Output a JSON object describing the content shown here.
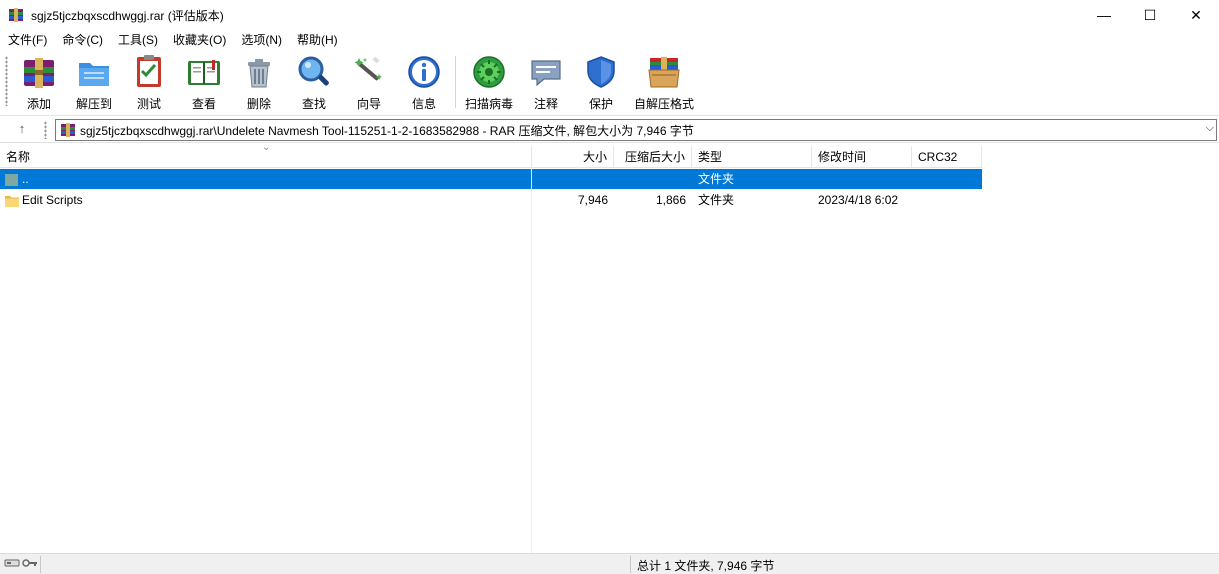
{
  "window": {
    "title": "sgjz5tjczbqxscdhwggj.rar (评估版本)",
    "minimize": "—",
    "maximize": "☐",
    "close": "✕"
  },
  "menu": [
    {
      "label": "文件(F)"
    },
    {
      "label": "命令(C)"
    },
    {
      "label": "工具(S)"
    },
    {
      "label": "收藏夹(O)"
    },
    {
      "label": "选项(N)"
    },
    {
      "label": "帮助(H)"
    }
  ],
  "toolbar": [
    {
      "label": "添加",
      "icon": "add-archive-icon"
    },
    {
      "label": "解压到",
      "icon": "extract-to-icon"
    },
    {
      "label": "测试",
      "icon": "test-icon"
    },
    {
      "label": "查看",
      "icon": "view-book-icon"
    },
    {
      "label": "删除",
      "icon": "trash-icon"
    },
    {
      "label": "查找",
      "icon": "magnifier-icon"
    },
    {
      "label": "向导",
      "icon": "wizard-wand-icon"
    },
    {
      "label": "信息",
      "icon": "info-icon"
    },
    {
      "label": "扫描病毒",
      "icon": "virus-scan-icon"
    },
    {
      "label": "注释",
      "icon": "comment-icon"
    },
    {
      "label": "保护",
      "icon": "shield-icon"
    },
    {
      "label": "自解压格式",
      "icon": "sfx-archive-icon"
    }
  ],
  "address": {
    "up": "↑",
    "path": "sgjz5tjczbqxscdhwggj.rar\\Undelete Navmesh Tool-115251-1-2-1683582988 - RAR 压缩文件, 解包大小为 7,946 字节",
    "dropdown": "⌵"
  },
  "columns": [
    {
      "label": "名称"
    },
    {
      "label": "大小"
    },
    {
      "label": "压缩后大小"
    },
    {
      "label": "类型"
    },
    {
      "label": "修改时间"
    },
    {
      "label": "CRC32"
    }
  ],
  "rows": [
    {
      "name": "..",
      "size": "",
      "packed": "",
      "type": "文件夹",
      "modified": "",
      "crc": "",
      "selected": true
    },
    {
      "name": "Edit Scripts",
      "size": "7,946",
      "packed": "1,866",
      "type": "文件夹",
      "modified": "2023/4/18 6:02",
      "crc": "",
      "selected": false
    }
  ],
  "status": {
    "summary": "总计 1 文件夹, 7,946 字节"
  },
  "colors": {
    "selection": "#0078d7",
    "folder": "#f8d775"
  }
}
